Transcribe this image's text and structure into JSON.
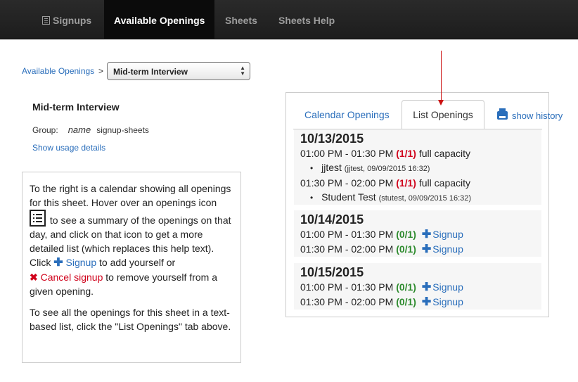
{
  "nav": {
    "signups": "Signups",
    "available": "Available Openings",
    "sheets": "Sheets",
    "help": "Sheets Help"
  },
  "breadcrumb": {
    "link": "Available Openings",
    "sep": ">",
    "select_value": "Mid-term Interview"
  },
  "sheet": {
    "title": "Mid-term Interview",
    "group_label": "Group:",
    "name_key": "name",
    "name_value": "signup-sheets",
    "usage_link": "Show usage details"
  },
  "help": {
    "p1_a": "To the right is a calendar showing all openings for this sheet. Hover over an openings icon",
    "p1_b": "to see a summary of the openings on that day, and click on that icon to get a more detailed list (which replaces this help text). Click",
    "signup_label": "Signup",
    "p1_c": "to add yourself or",
    "cancel_label": "Cancel signup",
    "p1_d": "to remove yourself from a given opening.",
    "p2": "To see all the openings for this sheet in a text-based list, click the \"List Openings\" tab above."
  },
  "tabs": {
    "calendar": "Calendar Openings",
    "list": "List Openings",
    "history": "show history"
  },
  "days": [
    {
      "date": "10/13/2015",
      "slots": [
        {
          "time": "01:00 PM - 01:30 PM",
          "count": "(1/1)",
          "status": "full capacity",
          "attendee": "jjtest",
          "meta": "(jjtest, 09/09/2015 16:32)"
        },
        {
          "time": "01:30 PM - 02:00 PM",
          "count": "(1/1)",
          "status": "full capacity",
          "attendee": "Student Test",
          "meta": "(stutest, 09/09/2015 16:32)"
        }
      ]
    },
    {
      "date": "10/14/2015",
      "slots": [
        {
          "time": "01:00 PM - 01:30 PM",
          "count": "(0/1)",
          "action": "Signup"
        },
        {
          "time": "01:30 PM - 02:00 PM",
          "count": "(0/1)",
          "action": "Signup"
        }
      ]
    },
    {
      "date": "10/15/2015",
      "slots": [
        {
          "time": "01:00 PM - 01:30 PM",
          "count": "(0/1)",
          "action": "Signup"
        },
        {
          "time": "01:30 PM - 02:00 PM",
          "count": "(0/1)",
          "action": "Signup"
        }
      ]
    }
  ],
  "colors": {
    "link": "#2a6ebb",
    "full": "#d0021b",
    "open": "#2e8b2e",
    "annotation_arrow": "#cc1111"
  }
}
